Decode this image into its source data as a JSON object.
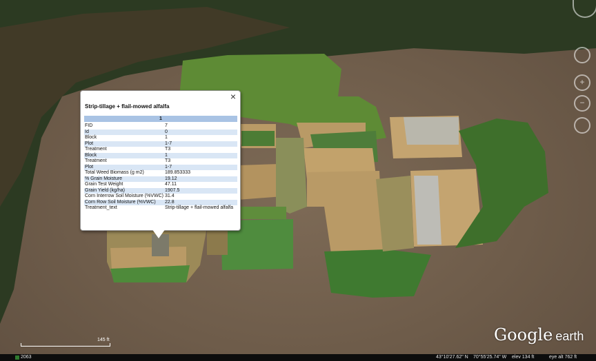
{
  "balloon": {
    "title": "Strip-tillage + flail-mowed alfalfa",
    "header": "1",
    "close_icon": "close-icon",
    "rows": [
      {
        "key": "FID",
        "value": "7"
      },
      {
        "key": "Id",
        "value": "0"
      },
      {
        "key": "Block",
        "value": "1"
      },
      {
        "key": "Plot",
        "value": "1-7"
      },
      {
        "key": "Treatment",
        "value": "T3"
      },
      {
        "key": "Block",
        "value": "1"
      },
      {
        "key": "Treatment",
        "value": "T3"
      },
      {
        "key": "Plot",
        "value": "1-7"
      },
      {
        "key": "Total Weed Biomass (g m2)",
        "value": "189.853333"
      },
      {
        "key": "% Grain Moisture",
        "value": "19.12"
      },
      {
        "key": "Grain Test Weight",
        "value": "47.11"
      },
      {
        "key": "Grain Yield (kg/ha)",
        "value": "1907.5"
      },
      {
        "key": "Corn Interrow Soil Moisture (%VWC)",
        "value": "31.4"
      },
      {
        "key": "Corn Row Soil Moisture (%VWC)",
        "value": "22.8"
      },
      {
        "key": "Treatment_text",
        "value": "Strip-tillage + flail-mowed alfalfa"
      }
    ]
  },
  "status_bar": {
    "imagery_date": "2063",
    "latitude": "43°10'27.62\" N",
    "longitude": "70°55'25.74\" W",
    "elevation": "elev  134 ft",
    "eye_alt": "eye alt  762 ft"
  },
  "scale": {
    "label": "145 ft"
  },
  "logo": {
    "google": "Google",
    "earth": "earth"
  },
  "nav": {
    "zoom_in": "+",
    "zoom_out": "−"
  },
  "colors": {
    "ground": "#6e5c4a",
    "grass": "#4f8a2a",
    "stubble": "#b69660",
    "forest": "#2c3a22",
    "balloon_header": "#a9c3e4"
  }
}
